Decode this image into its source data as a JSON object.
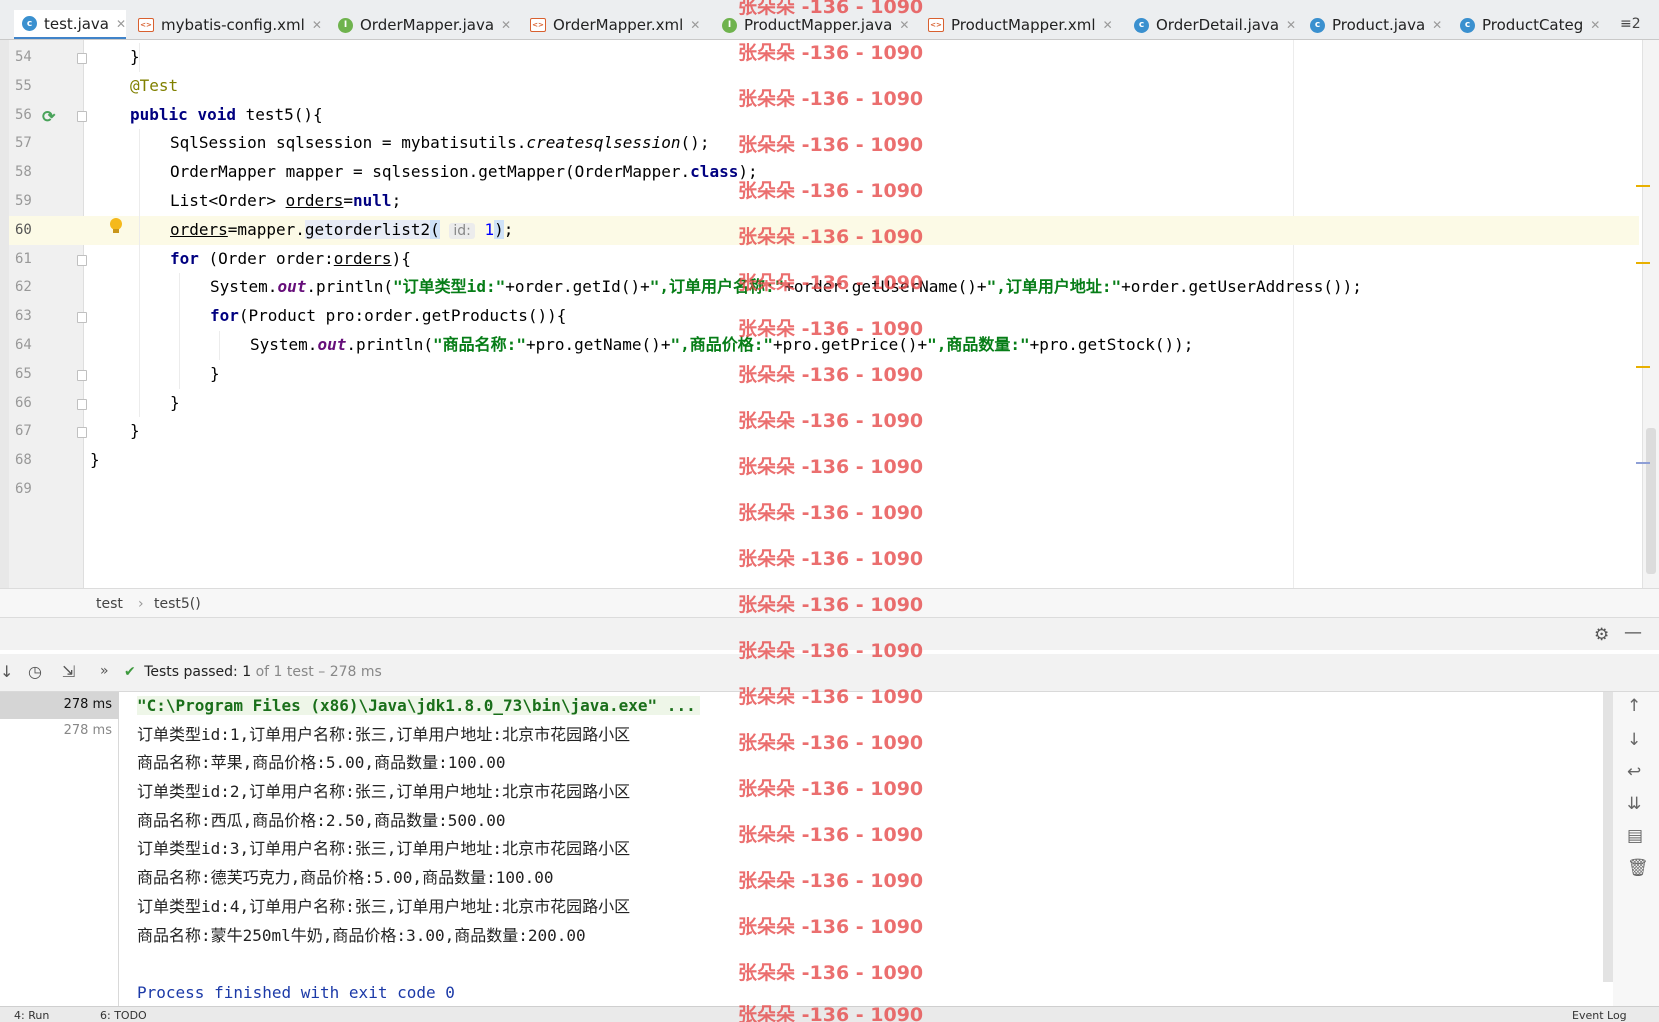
{
  "tabs": [
    {
      "label": "test.java",
      "icon": "c",
      "active": true
    },
    {
      "label": "mybatis-config.xml",
      "icon": "x"
    },
    {
      "label": "OrderMapper.java",
      "icon": "i"
    },
    {
      "label": "OrderMapper.xml",
      "icon": "x"
    },
    {
      "label": "ProductMapper.java",
      "icon": "i"
    },
    {
      "label": "ProductMapper.xml",
      "icon": "x"
    },
    {
      "label": "OrderDetail.java",
      "icon": "c"
    },
    {
      "label": "Product.java",
      "icon": "c"
    },
    {
      "label": "ProductCateg",
      "icon": "c"
    }
  ],
  "tab_more": "≡2",
  "code": {
    "lines": [
      "54",
      "55",
      "56",
      "57",
      "58",
      "59",
      "60",
      "61",
      "62",
      "63",
      "64",
      "65",
      "66",
      "67",
      "68",
      "69"
    ],
    "annotation": "@Test",
    "kw_public": "public",
    "kw_void": "void",
    "method_decl": "test5(){",
    "sqlsession_type": "SqlSession sqlsession = mybatisutils.",
    "create_call": "createsqlsession",
    "create_end": "();",
    "mapper_line": "OrderMapper mapper = sqlsession.getMapper(OrderMapper.",
    "kw_class": "class",
    "mapper_end": ");",
    "list_prefix": "List<Order> ",
    "orders_var": "orders",
    "assign_null": "=",
    "kw_null": "null",
    "semi": ";",
    "orders_var2": "orders",
    "call_prefix": "=mapper.",
    "call_method": "getorderlist2",
    "paren_open": "(",
    "hint_label": "id:",
    "arg_value": "1",
    "paren_close": ")",
    "semi2": ";",
    "kw_for": "for",
    "for_decl": " (Order order:",
    "orders_var3": "orders",
    "for_end": "){",
    "sys1": "System.",
    "out1": "out",
    "println1": ".println(",
    "str1a": "\"订单类型id:\"",
    "cat1a": "+order.getId()+",
    "str1b": "\",订单用户名称:\"",
    "cat1b": "+order.getUserName()+",
    "str1c": "\",订单用户地址:\"",
    "cat1c": "+order.getUserAddress());",
    "kw_for2": "for",
    "for2_decl": "(Product pro:order.getProducts()){",
    "sys2": "System.",
    "out2": "out",
    "println2": ".println(",
    "str2a": "\"商品名称:\"",
    "cat2a": "+pro.getName()+",
    "str2b": "\",商品价格:\"",
    "cat2b": "+pro.getPrice()+",
    "str2c": "\",商品数量:\"",
    "cat2c": "+pro.getStock());",
    "brace": "}"
  },
  "breadcrumb": [
    "test",
    "test5()"
  ],
  "run_panel": {
    "tests_label": "Tests passed:",
    "tests_count": "1",
    "tests_rest": "of 1 test – 278 ms",
    "tree_time_selected": "278 ms",
    "tree_time": "278 ms"
  },
  "console": {
    "command": "\"C:\\Program Files (x86)\\Java\\jdk1.8.0_73\\bin\\java.exe\" ...",
    "output": [
      "订单类型id:1,订单用户名称:张三,订单用户地址:北京市花园路小区",
      "商品名称:苹果,商品价格:5.00,商品数量:100.00",
      "订单类型id:2,订单用户名称:张三,订单用户地址:北京市花园路小区",
      "商品名称:西瓜,商品价格:2.50,商品数量:500.00",
      "订单类型id:3,订单用户名称:张三,订单用户地址:北京市花园路小区",
      "商品名称:德芙巧克力,商品价格:5.00,商品数量:100.00",
      "订单类型id:4,订单用户名称:张三,订单用户地址:北京市花园路小区",
      "商品名称:蒙牛250ml牛奶,商品价格:3.00,商品数量:200.00"
    ],
    "finished": "Process finished with exit code 0"
  },
  "statusbar": {
    "run": "4: Run",
    "todo": "6: TODO",
    "event_log": "Event Log"
  },
  "watermark": "张朵朵 -136 - 1090"
}
